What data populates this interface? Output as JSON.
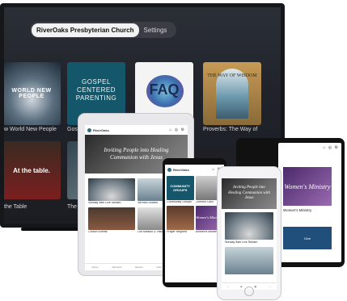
{
  "tv": {
    "tabs": {
      "active": "RiverOaks Presbyterian Church",
      "other": "Settings"
    },
    "row1": [
      {
        "title_art": "WORLD NEW PEOPLE",
        "caption": "w World New People"
      },
      {
        "title_art": "GOSPEL CENTERED PARENTING",
        "caption": "Gosp"
      },
      {
        "title_art": "FAQ",
        "caption": ""
      },
      {
        "title_art": "THE WAY OF WISDOM",
        "caption": "Proverbs: The Way of"
      }
    ],
    "row2": [
      {
        "title_art": "At the table.",
        "caption": "the Table"
      },
      {
        "title_art": "",
        "caption": "The S"
      }
    ]
  },
  "tablet": {
    "app_name": "RiverOaks",
    "hero_text": "Inviting People into Healing Communion with Jesus",
    "cards": [
      {
        "label": "Sunday 9am Live Stream"
      },
      {
        "label": "Sermon Guides"
      },
      {
        "label": "Church Events"
      },
      {
        "label": "Our Mission & Vision"
      }
    ],
    "nav": [
      "Home",
      "Sermons",
      "Events",
      "Give",
      "More"
    ]
  },
  "android": {
    "app_name": "RiverOaks",
    "tiles": [
      {
        "title_art": "COMMUNITY GROUPS",
        "label": "Community Groups"
      },
      {
        "label": "Connect Card"
      },
      {
        "label": "Prayer Request"
      },
      {
        "title_art": "Women's Ministry",
        "label": "Women's Ministry"
      }
    ]
  },
  "iphone": {
    "hero_text": "Inviting People into Healing Communion with Jesus",
    "card_label": "Sunday 9am Live Stream"
  },
  "tablet_landscape": {
    "tile_title": "Women's Ministry",
    "label": "Women's Ministry",
    "give_label": "Give"
  }
}
